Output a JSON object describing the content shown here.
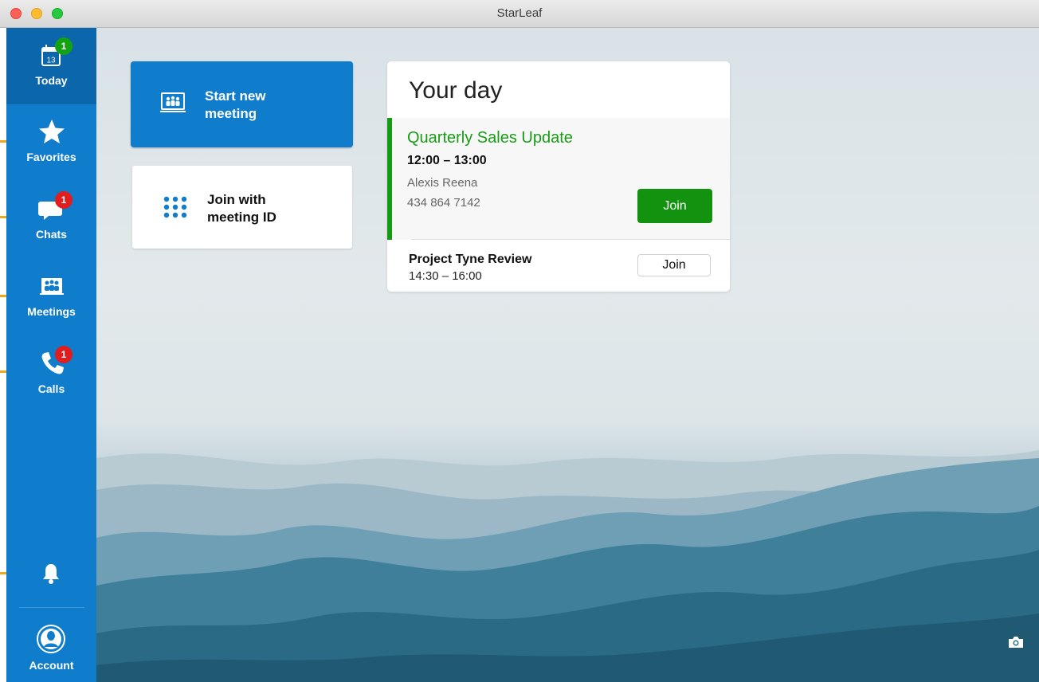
{
  "window": {
    "title": "StarLeaf"
  },
  "sidebar": {
    "items": [
      {
        "label": "Today",
        "badge": "1",
        "date": "13",
        "icon": "calendar-icon",
        "active": true
      },
      {
        "label": "Favorites",
        "icon": "star-icon"
      },
      {
        "label": "Chats",
        "badge": "1",
        "icon": "chat-bubble-icon"
      },
      {
        "label": "Meetings",
        "icon": "meeting-people-icon"
      },
      {
        "label": "Calls",
        "badge": "1",
        "icon": "phone-icon"
      }
    ],
    "notifications_icon": "bell-icon",
    "account": {
      "label": "Account",
      "icon": "user-avatar-icon"
    }
  },
  "actions": {
    "start_meeting": {
      "label_line1": "Start new",
      "label_line2": "meeting",
      "icon": "presentation-people-icon"
    },
    "join_meeting": {
      "label_line1": "Join with",
      "label_line2": "meeting ID",
      "icon": "keypad-icon"
    }
  },
  "your_day": {
    "title": "Your day",
    "meetings": [
      {
        "title": "Quarterly Sales Update",
        "time": "12:00 – 13:00",
        "host": "Alexis Reena",
        "phone": "434 864 7142",
        "join_label": "Join"
      },
      {
        "title": "Project Tyne Review",
        "time": "14:30 – 16:00",
        "join_label": "Join"
      }
    ]
  },
  "colors": {
    "brand_blue": "#0f7ccc",
    "active_blue": "#0b66ab",
    "green": "#12920f",
    "badge_red": "#e11d1d",
    "badge_green": "#13a312"
  },
  "background_icon": "camera-icon"
}
